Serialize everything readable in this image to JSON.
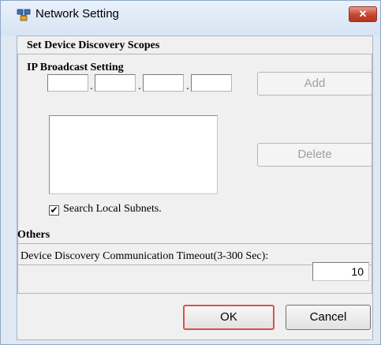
{
  "window": {
    "title": "Network Setting",
    "close_label": "✕"
  },
  "discovery": {
    "section_title": "Set Device Discovery Scopes",
    "ip_group_title": "IP Broadcast Setting",
    "ip_octets": [
      "",
      "",
      "",
      ""
    ],
    "add_label": "Add",
    "delete_label": "Delete",
    "broadcast_list": [],
    "search_local_subnets": {
      "label": "Search Local Subnets.",
      "checked": true
    }
  },
  "others": {
    "section_title": "Others",
    "timeout_label": "Device Discovery Communication Timeout(3-300 Sec):",
    "timeout_value": "10"
  },
  "footer": {
    "ok_label": "OK",
    "cancel_label": "Cancel"
  },
  "colors": {
    "title_bar": "#d7e4f3",
    "close_button": "#c4452f",
    "ok_focus_border": "#d9534a"
  }
}
